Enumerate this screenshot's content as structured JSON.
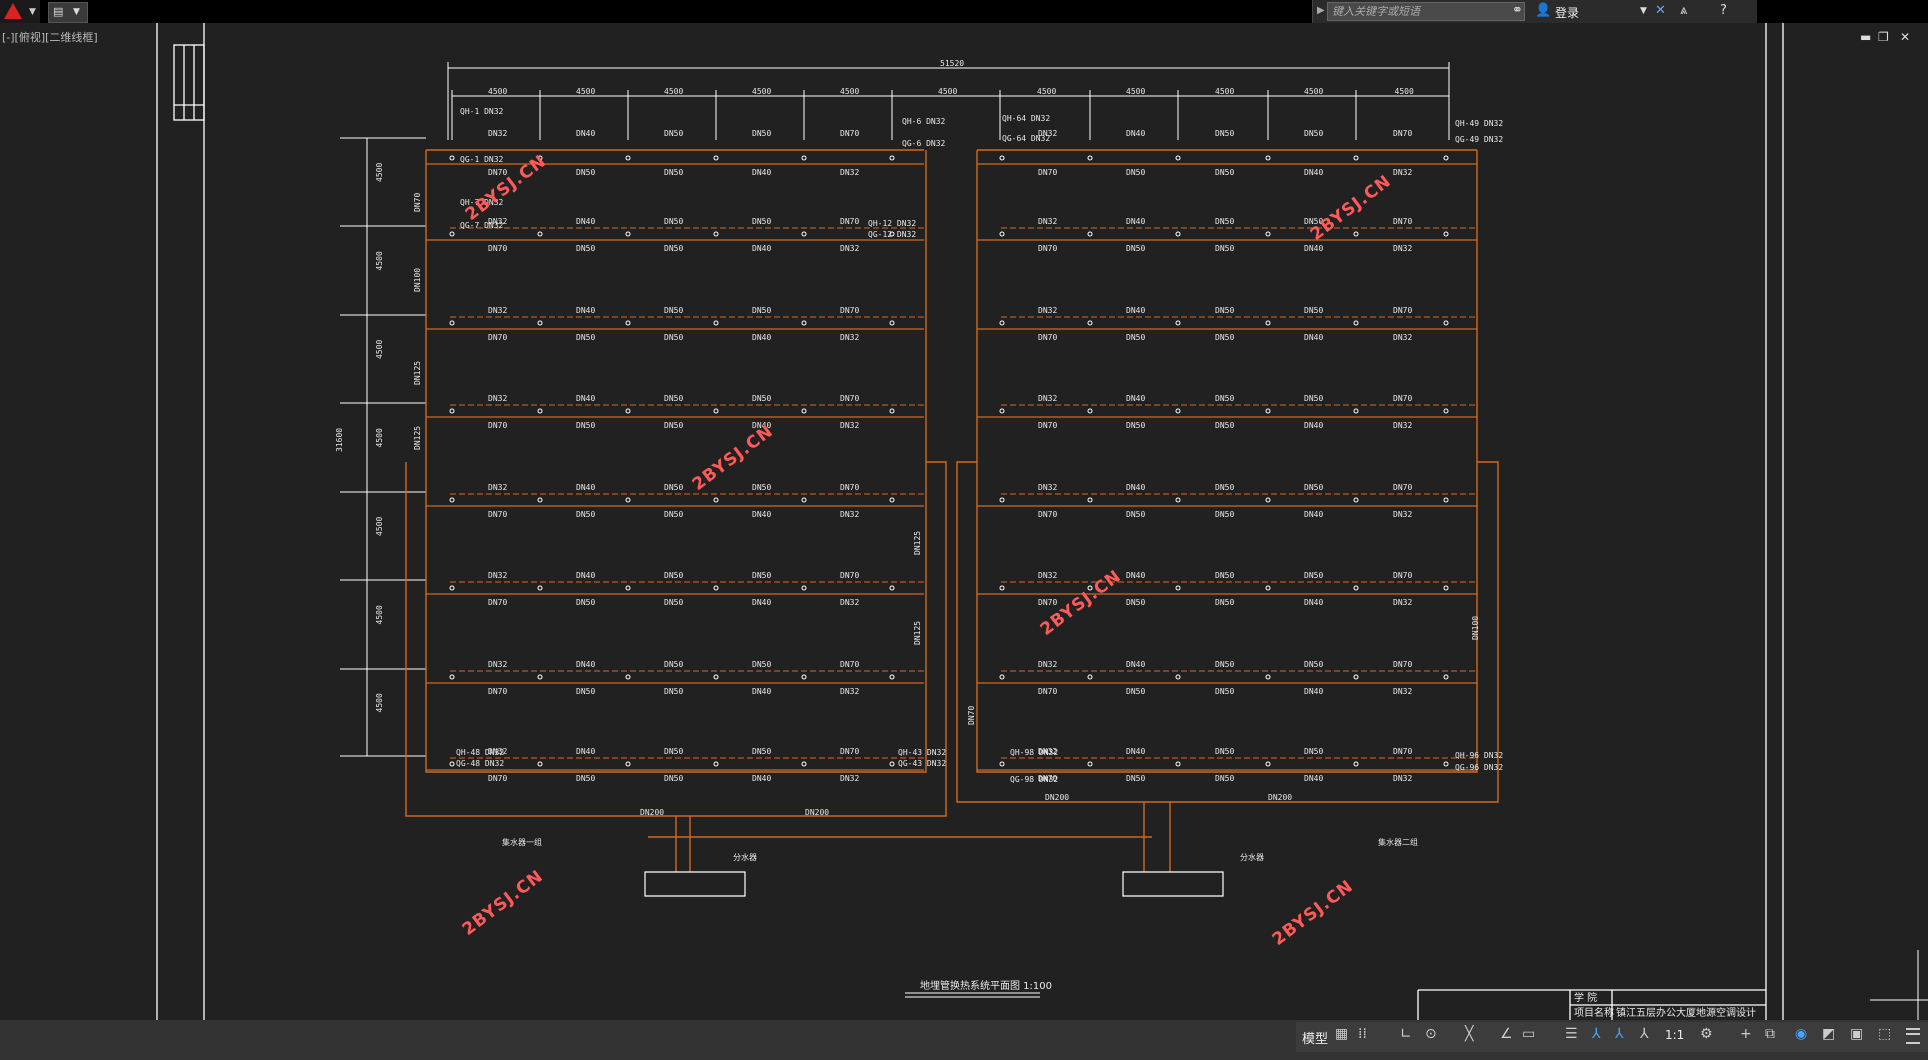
{
  "app": {
    "search_placeholder": "键入关键字或短语",
    "login_label": "登录",
    "viewport_label": "[-][俯视][二维线框]"
  },
  "icons": {
    "app_menu": "autocad-logo-icon",
    "quick_access": "open-file-icon",
    "binoculars": "binoculars-icon",
    "user": "user-icon",
    "exchange": "exchange-x-icon",
    "a360": "a360-icon",
    "help": "help-icon"
  },
  "drawing": {
    "overall_dim": "51520",
    "vertical_dim": "31600",
    "bay_dims": [
      "4500",
      "4500",
      "4500",
      "4500",
      "4500",
      "4500",
      "4500",
      "4500",
      "4500",
      "4500",
      "4500"
    ],
    "row_dims": [
      "4500",
      "4500",
      "4500",
      "4500",
      "4500",
      "4500",
      "4500"
    ],
    "watermark": "2BYSJ.CN",
    "caption": "地埋管换热系统平面图 1:100",
    "main_pipe_labels": [
      "DN200",
      "DN200",
      "DN200",
      "DN200"
    ],
    "riser_labels": [
      "DN70",
      "DN100",
      "DN125",
      "DN125",
      "DN125",
      "DN125",
      "DN100",
      "DN70"
    ],
    "branch_labels_top": [
      "DN32",
      "DN40",
      "DN50",
      "DN50",
      "DN70"
    ],
    "branch_labels_bottom": [
      "DN70",
      "DN50",
      "DN50",
      "DN40",
      "DN32"
    ],
    "loop_tags": [
      "QH-1 DN32",
      "QG-1 DN32",
      "QH-6 DN32",
      "QG-6 DN32",
      "QH-7 DN32",
      "QG-7 DN32",
      "QH-12 DN32",
      "QG-12 DN32",
      "QH-48 DN32",
      "QG-48 DN32",
      "QH-43 DN32",
      "QG-43 DN32",
      "QH-64 DN32",
      "QG-64 DN32",
      "QH-49 DN32",
      "QG-49 DN32",
      "QH-98 DN32",
      "QG-98 DN32",
      "QH-96 DN32",
      "QG-96 DN32"
    ],
    "manifold_labels": [
      "集水器一组",
      "集水器二组",
      "分水器",
      "分水器"
    ],
    "titleblock": {
      "row1_label": "学 院",
      "row2_label": "项目名称",
      "row2_value": "镇江五层办公大厦地源空调设计"
    }
  },
  "statusbar": {
    "model_tab": "模型",
    "scale": "1:1"
  },
  "colors": {
    "pipe": "#d2691e",
    "background": "#212121",
    "watermark": "#ff5a5a",
    "line": "#ffffff"
  }
}
